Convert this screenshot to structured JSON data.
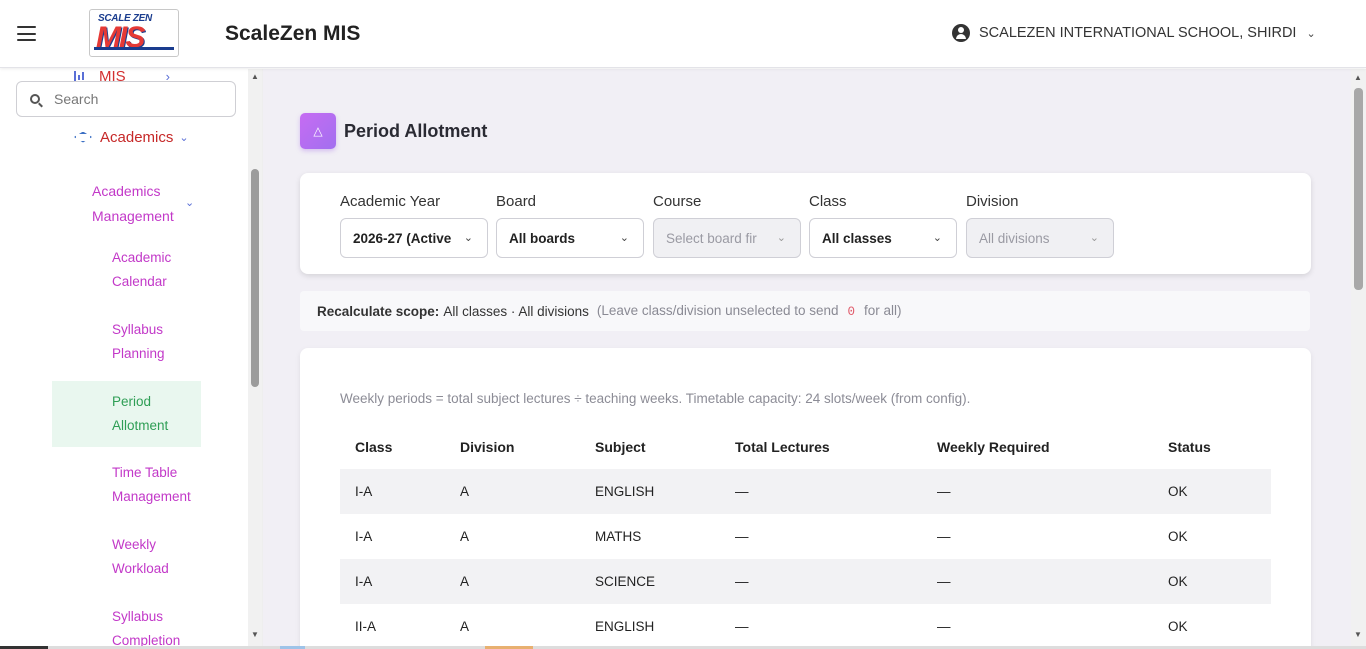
{
  "header": {
    "logo_top": "SCALE ZEN",
    "logo_main": "MIS",
    "app_title": "ScaleZen MIS",
    "school_name": "SCALEZEN INTERNATIONAL SCHOOL, SHIRDI"
  },
  "sidebar": {
    "mis_label": "MIS",
    "search_placeholder": "Search",
    "academics_label": "Academics",
    "academics_management_label": [
      "Academics",
      "Management"
    ],
    "items": [
      {
        "line1": "Academic",
        "line2": "Calendar",
        "active": false
      },
      {
        "line1": "Syllabus",
        "line2": "Planning",
        "active": false
      },
      {
        "line1": "Period",
        "line2": "Allotment",
        "active": true
      },
      {
        "line1": "Time Table",
        "line2": "Management",
        "active": false
      },
      {
        "line1": "Weekly",
        "line2": "Workload",
        "active": false
      },
      {
        "line1": "Syllabus",
        "line2": "Completion",
        "active": false
      }
    ]
  },
  "page": {
    "title": "Period Allotment",
    "icon": "graduation-cap-icon"
  },
  "filters": {
    "academic_year": {
      "label": "Academic Year",
      "value": "2026-27 (Active"
    },
    "board": {
      "label": "Board",
      "value": "All boards"
    },
    "course": {
      "label": "Course",
      "value": "Select board fir"
    },
    "class": {
      "label": "Class",
      "value": "All classes"
    },
    "division": {
      "label": "Division",
      "value": "All divisions"
    }
  },
  "scope": {
    "label": "Recalculate scope:",
    "value": "All classes · All divisions",
    "hint_before": "(Leave class/division unselected to send",
    "hint_code": "0",
    "hint_after": "for all)"
  },
  "table": {
    "note": "Weekly periods = total subject lectures ÷ teaching weeks. Timetable capacity: 24 slots/week (from config).",
    "columns": [
      "Class",
      "Division",
      "Subject",
      "Total Lectures",
      "Weekly Required",
      "Status"
    ],
    "rows": [
      [
        "I-A",
        "A",
        "ENGLISH",
        "—",
        "—",
        "OK"
      ],
      [
        "I-A",
        "A",
        "MATHS",
        "—",
        "—",
        "OK"
      ],
      [
        "I-A",
        "A",
        "SCIENCE",
        "—",
        "—",
        "OK"
      ],
      [
        "II-A",
        "A",
        "ENGLISH",
        "—",
        "—",
        "OK"
      ]
    ]
  },
  "colors": {
    "active_item_bg": "#e9f7ef",
    "active_item_text": "#2e9e55",
    "menu_text": "#c238c8",
    "academics_text": "#c62828",
    "main_bg": "#f1eff5",
    "accent_purple": "#b06cf2"
  }
}
